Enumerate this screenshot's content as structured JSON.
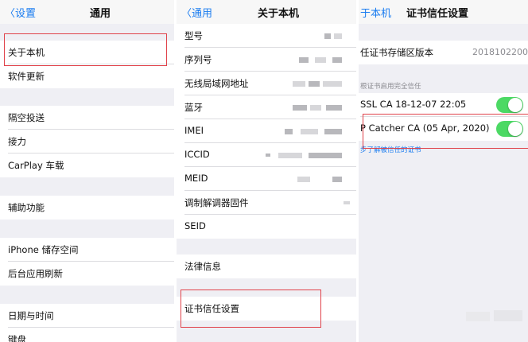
{
  "panel1": {
    "back_label": "设置",
    "title": "通用",
    "items": [
      "关于本机",
      "软件更新",
      "隔空投送",
      "接力",
      "CarPlay 车载",
      "辅助功能",
      "iPhone 储存空间",
      "后台应用刷新",
      "日期与时间",
      "键盘"
    ]
  },
  "panel2": {
    "back_label": "通用",
    "title": "关于本机",
    "items": [
      "型号",
      "序列号",
      "无线局域网地址",
      "蓝牙",
      "IMEI",
      "ICCID",
      "MEID",
      "调制解调器固件",
      "SEID",
      "法律信息",
      "证书信任设置"
    ]
  },
  "panel3": {
    "back_label": "于本机",
    "title": "证书信任设置",
    "trust_store_label": "任证书存储区版本",
    "trust_store_value": "2018102200",
    "section_header": "根证书启用完全信任",
    "cert1_label": "SSL CA 18-12-07 22:05",
    "cert2_label": "P Catcher CA (05 Apr, 2020)",
    "learn_more_link": "步了解被信任的证书"
  },
  "colors": {
    "accent": "#1a7cf0",
    "highlight_box": "#e0424a",
    "toggle_on": "#4cd964"
  }
}
